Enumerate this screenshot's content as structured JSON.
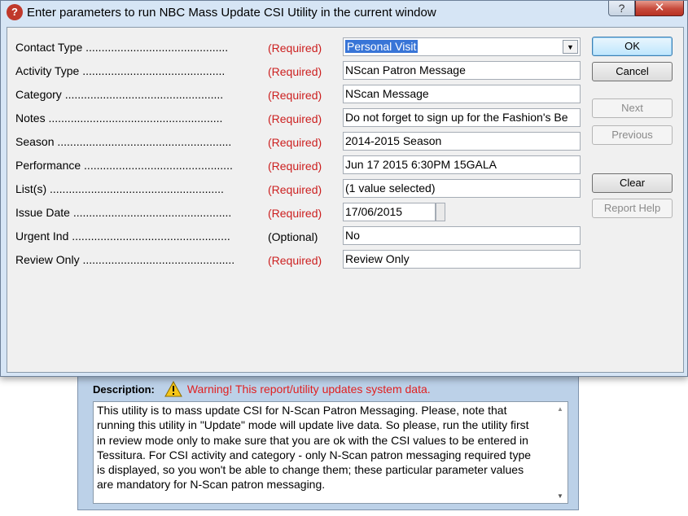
{
  "dialog": {
    "title": "Enter parameters to run NBC Mass Update CSI Utility in the current window",
    "app_icon": "tessitura-logo-icon",
    "help_glyph": "?",
    "close_glyph": "✕"
  },
  "parameters": [
    {
      "label": "Contact Type .............................................",
      "status": "(Required)",
      "value": "Personal Visit",
      "type": "select"
    },
    {
      "label": "Activity Type .............................................",
      "status": "(Required)",
      "value": "NScan Patron Message",
      "type": "text"
    },
    {
      "label": "Category ..................................................",
      "status": "(Required)",
      "value": "NScan Message",
      "type": "text"
    },
    {
      "label": "Notes .......................................................",
      "status": "(Required)",
      "value": "Do not forget to sign up for the Fashion's Be",
      "type": "text"
    },
    {
      "label": "Season .......................................................",
      "status": "(Required)",
      "value": "2014-2015 Season",
      "type": "text"
    },
    {
      "label": "Performance ...............................................",
      "status": "(Required)",
      "value": "Jun 17 2015  6:30PM 15GALA",
      "type": "text"
    },
    {
      "label": "List(s) .......................................................",
      "status": "(Required)",
      "value": "(1 value selected)",
      "type": "text"
    },
    {
      "label": "Issue Date ..................................................",
      "status": "(Required)",
      "value": "17/06/2015",
      "type": "date"
    },
    {
      "label": "Urgent Ind ..................................................",
      "status": "(Optional)",
      "value": "No",
      "type": "text"
    },
    {
      "label": "Review Only ................................................",
      "status": "(Required)",
      "value": "Review Only",
      "type": "text"
    }
  ],
  "buttons": {
    "ok": "OK",
    "cancel": "Cancel",
    "next": "Next",
    "previous": "Previous",
    "clear": "Clear",
    "report_help": "Report Help"
  },
  "description": {
    "label": "Description:",
    "warning": "Warning! This report/utility updates system data.",
    "text": "This utility is to mass update CSI for N-Scan Patron Messaging. Please, note that running this utility in \"Update\" mode will  update live data. So please, run the utility first in review mode only to make sure that you are ok with the CSI values to be entered in Tessitura. For CSI activity and category - only N-Scan patron messaging required type is displayed, so you won't be able to change them; these particular parameter values are mandatory for N-Scan patron messaging.",
    "warning_icon": "warning-icon"
  },
  "colors": {
    "required": "#cc1f1f",
    "dialog_bg": "#d6e5f5",
    "selection": "#3875d7",
    "warning": "#e02020"
  }
}
